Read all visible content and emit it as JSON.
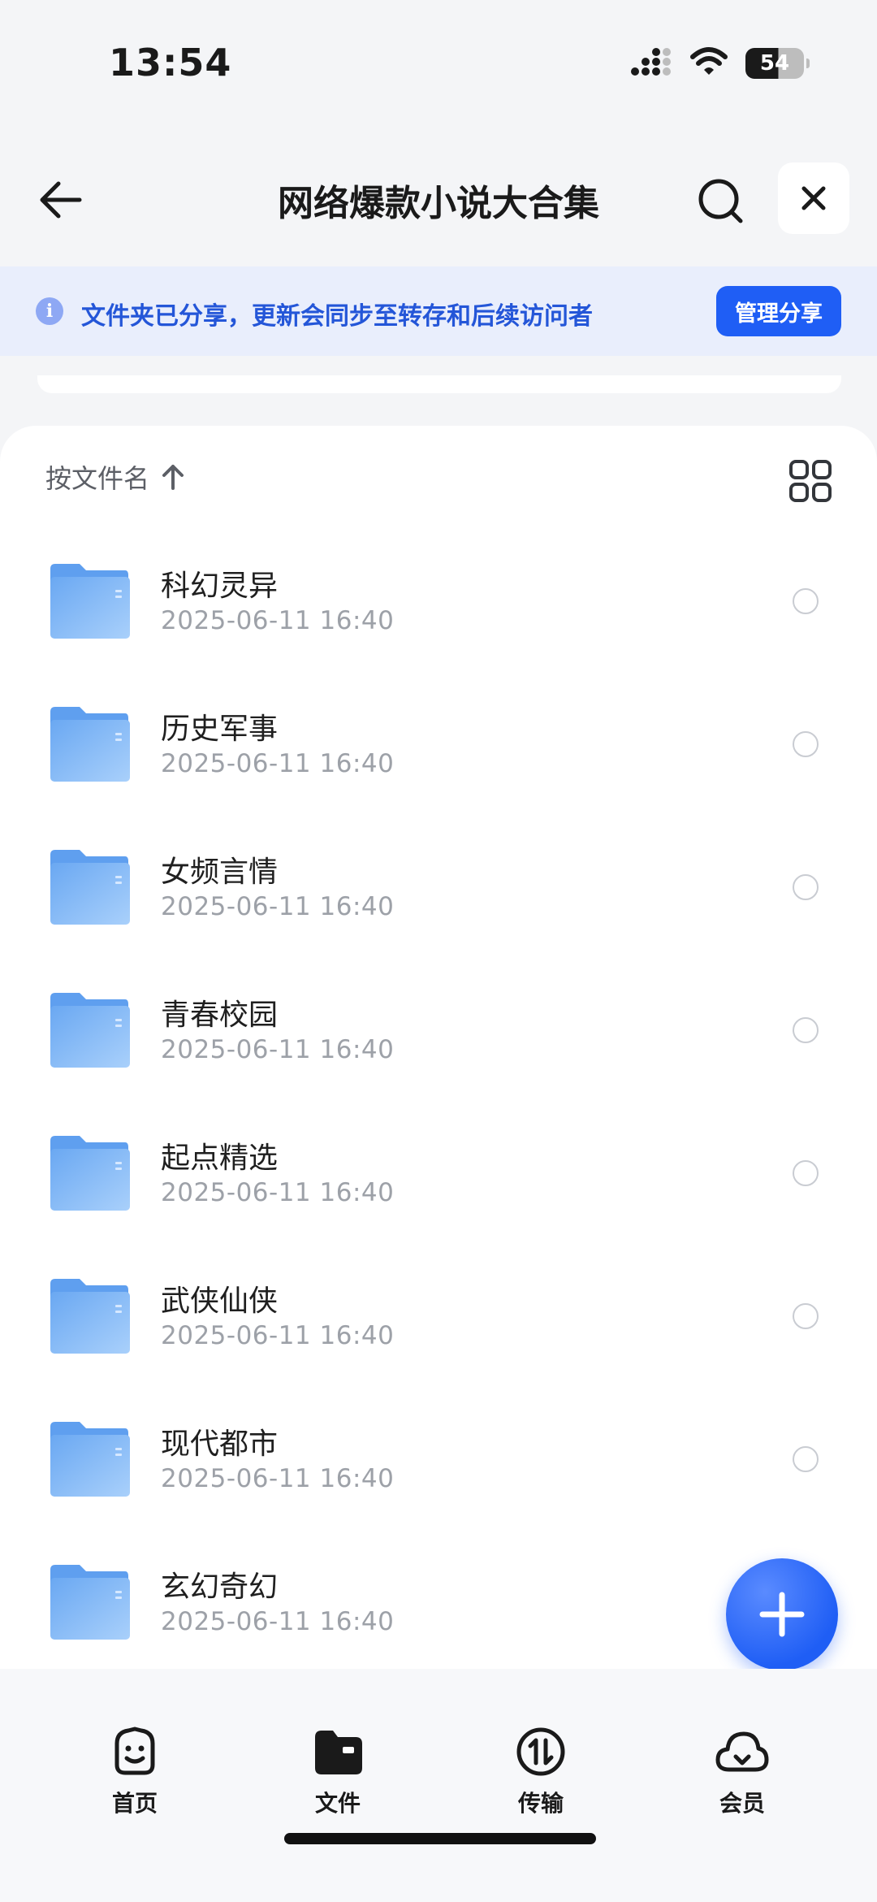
{
  "status_bar": {
    "time": "13:54",
    "battery": "54"
  },
  "header": {
    "title": "网络爆款小说大合集"
  },
  "share_banner": {
    "text": "文件夹已分享，更新会同步至转存和后续访问者",
    "button_label": "管理分享"
  },
  "list": {
    "sort_label": "按文件名",
    "items": [
      {
        "name": "科幻灵异",
        "date": "2025-06-11 16:40"
      },
      {
        "name": "历史军事",
        "date": "2025-06-11 16:40"
      },
      {
        "name": "女频言情",
        "date": "2025-06-11 16:40"
      },
      {
        "name": "青春校园",
        "date": "2025-06-11 16:40"
      },
      {
        "name": "起点精选",
        "date": "2025-06-11 16:40"
      },
      {
        "name": "武侠仙侠",
        "date": "2025-06-11 16:40"
      },
      {
        "name": "现代都市",
        "date": "2025-06-11 16:40"
      },
      {
        "name": "玄幻奇幻",
        "date": "2025-06-11 16:40"
      }
    ]
  },
  "bottom_nav": {
    "items": [
      {
        "label": "首页",
        "icon": "smile-home-icon"
      },
      {
        "label": "文件",
        "icon": "folder-file-icon"
      },
      {
        "label": "传输",
        "icon": "transfer-icon"
      },
      {
        "label": "会员",
        "icon": "cloud-member-icon"
      }
    ]
  },
  "colors": {
    "accent": "#1f5ef5",
    "banner_bg": "#e9eefc",
    "banner_text": "#2456d8",
    "folder": "#7fb6f5"
  }
}
